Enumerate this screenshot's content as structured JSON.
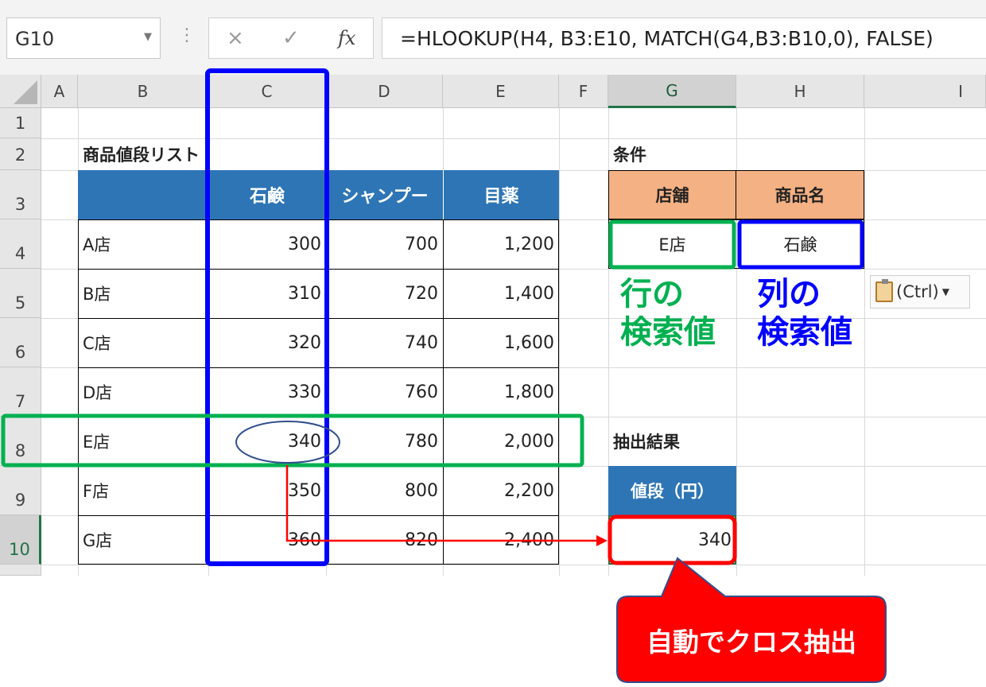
{
  "formula_bar": {
    "name_box": "G10",
    "cancel_icon": "×",
    "enter_icon": "✓",
    "fx_label": "fx",
    "formula": "=HLOOKUP(H4, B3:E10, MATCH(G4,B3:B10,0), FALSE)"
  },
  "columns": [
    "A",
    "B",
    "C",
    "D",
    "E",
    "F",
    "G",
    "H",
    "I"
  ],
  "rows": [
    "1",
    "2",
    "3",
    "4",
    "5",
    "6",
    "7",
    "8",
    "9",
    "10"
  ],
  "price_list": {
    "title": "商品値段リスト",
    "headers": [
      "",
      "石鹸",
      "シャンプー",
      "目薬"
    ],
    "stores": [
      {
        "name": "A店",
        "values": [
          "300",
          "700",
          "1,200"
        ]
      },
      {
        "name": "B店",
        "values": [
          "310",
          "720",
          "1,400"
        ]
      },
      {
        "name": "C店",
        "values": [
          "320",
          "740",
          "1,600"
        ]
      },
      {
        "name": "D店",
        "values": [
          "330",
          "760",
          "1,800"
        ]
      },
      {
        "name": "E店",
        "values": [
          "340",
          "780",
          "2,000"
        ]
      },
      {
        "name": "F店",
        "values": [
          "350",
          "800",
          "2,200"
        ]
      },
      {
        "name": "G店",
        "values": [
          "360",
          "820",
          "2,400"
        ]
      }
    ]
  },
  "conditions": {
    "title": "条件",
    "store_header": "店舗",
    "product_header": "商品名",
    "store_value": "E店",
    "product_value": "石鹸"
  },
  "result": {
    "title": "抽出結果",
    "header": "値段（円）",
    "value": "340"
  },
  "annotations": {
    "row_lookup_line1": "行の",
    "row_lookup_line2": "検索値",
    "col_lookup_line1": "列の",
    "col_lookup_line2": "検索値",
    "callout": "自動でクロス抽出",
    "paste_options": "(Ctrl)"
  },
  "colors": {
    "green": "#00b050",
    "blue": "#0000ff",
    "red": "#ff0000",
    "header_blue": "#2e75b6",
    "header_orange": "#f4b183",
    "excel_green": "#217346"
  }
}
